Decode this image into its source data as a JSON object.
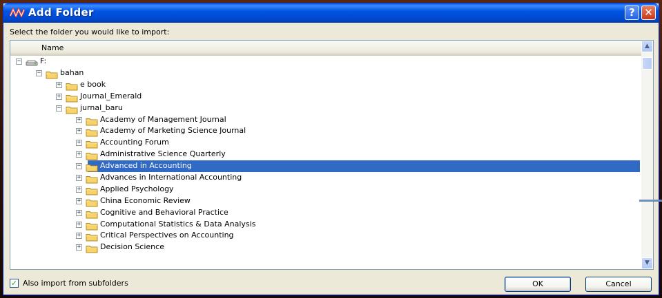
{
  "window": {
    "title": "Add Folder",
    "help_glyph": "?",
    "close_glyph": "✕",
    "colors": {
      "titlebar": "#0054e3",
      "selection": "#316ac5",
      "dialog_bg": "#ece9d8"
    }
  },
  "prompt": "Select the folder you would like to import:",
  "tree": {
    "column_header": "Name",
    "items": [
      {
        "label": "F:",
        "level": 0,
        "expander": "−",
        "icon": "drive-icon",
        "selected": false
      },
      {
        "label": "bahan",
        "level": 1,
        "expander": "−",
        "icon": "folder-icon",
        "selected": false
      },
      {
        "label": "e book",
        "level": 2,
        "expander": "+",
        "icon": "folder-icon",
        "selected": false
      },
      {
        "label": "Journal_Emerald",
        "level": 2,
        "expander": "+",
        "icon": "folder-icon",
        "selected": false
      },
      {
        "label": "jurnal_baru",
        "level": 2,
        "expander": "−",
        "icon": "folder-icon",
        "selected": false
      },
      {
        "label": "Academy of Management Journal",
        "level": 3,
        "expander": "+",
        "icon": "folder-icon",
        "selected": false
      },
      {
        "label": "Academy of Marketing Science Journal",
        "level": 3,
        "expander": "+",
        "icon": "folder-icon",
        "selected": false
      },
      {
        "label": "Accounting Forum",
        "level": 3,
        "expander": "+",
        "icon": "folder-icon",
        "selected": false
      },
      {
        "label": "Administrative Science Quarterly",
        "level": 3,
        "expander": "+",
        "icon": "folder-icon",
        "selected": false
      },
      {
        "label": "Advanced in Accounting",
        "level": 3,
        "expander": "−",
        "icon": "folder-icon",
        "selected": true
      },
      {
        "label": "Advances in International Accounting",
        "level": 3,
        "expander": "+",
        "icon": "folder-icon",
        "selected": false
      },
      {
        "label": "Applied Psychology",
        "level": 3,
        "expander": "+",
        "icon": "folder-icon",
        "selected": false
      },
      {
        "label": "China Economic Review",
        "level": 3,
        "expander": "+",
        "icon": "folder-icon",
        "selected": false
      },
      {
        "label": "Cognitive and Behavioral Practice",
        "level": 3,
        "expander": "+",
        "icon": "folder-icon",
        "selected": false
      },
      {
        "label": "Computational Statistics & Data Analysis",
        "level": 3,
        "expander": "+",
        "icon": "folder-icon",
        "selected": false
      },
      {
        "label": "Critical Perspectives on Accounting",
        "level": 3,
        "expander": "+",
        "icon": "folder-icon",
        "selected": false
      },
      {
        "label": "Decision Science",
        "level": 3,
        "expander": "+",
        "icon": "folder-icon",
        "selected": false
      }
    ]
  },
  "scrollbar": {
    "up_glyph": "▲",
    "down_glyph": "▼"
  },
  "subfolders": {
    "label": "Also import from subfolders",
    "checked": true,
    "check_glyph": "✓"
  },
  "buttons": {
    "ok": "OK",
    "cancel": "Cancel"
  }
}
